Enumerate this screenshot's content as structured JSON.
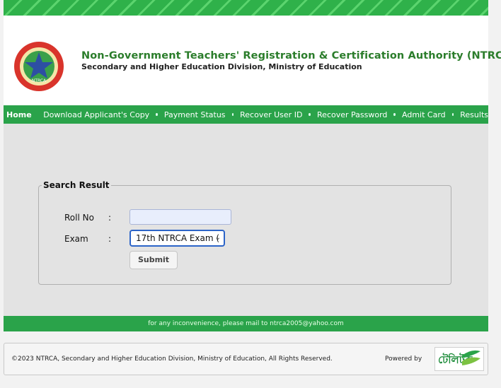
{
  "header": {
    "title": "Non-Government Teachers' Registration & Certification Authority (NTRCA)",
    "subtitle": "Secondary and Higher Education Division, Ministry of Education",
    "logo_text": "NTRCA"
  },
  "nav": {
    "home": "Home",
    "items": [
      "Download Applicant's Copy",
      "Payment Status",
      "Recover User ID",
      "Recover Password",
      "Admit Card",
      "Results"
    ]
  },
  "search": {
    "legend": "Search Result",
    "roll_label": "Roll No",
    "exam_label": "Exam",
    "colon": ":",
    "roll_value": "",
    "exam_selected": "17th NTRCA Exam (",
    "submit_label": "Submit"
  },
  "mail_notice": "for any inconvenience, please mail to ntrca2005@yahoo.com",
  "footer": {
    "copyright": "©2023 NTRCA, Secondary and Higher Education Division, Ministry of Education, All Rights Reserved.",
    "powered_by": "Powered by",
    "partner_logo_text": "টেলিটক"
  },
  "colors": {
    "brand_green": "#2aa34a",
    "title_green": "#2b7d2b",
    "focus_blue": "#2c64c8"
  }
}
